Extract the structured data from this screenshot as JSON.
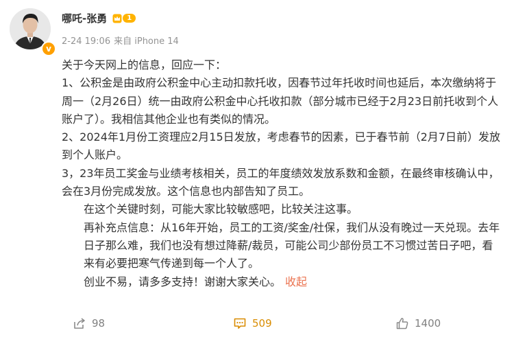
{
  "author": {
    "name": "哪吒-张勇",
    "level_badge": "1",
    "verified_mark": "v",
    "avatar": "avatar-photo"
  },
  "meta": {
    "time": "2-24 19:06",
    "source": "来自 iPhone 14"
  },
  "post": {
    "paragraphs": [
      "关于今天网上的信息，回应一下：",
      "1、公积金是由政府公积金中心主动扣款托收，因春节过年托收时间也延后，本次缴纳将于周一（2月26日）统一由政府公积金中心托收扣款（部分城市已经于2月23日前托收到个人账户了）。我相信其他企业也有类似的情况。",
      "2、2024年1月份工资理应2月15日发放，考虑春节的因素，已于春节前（2月7日前）发放到个人账户。",
      "3，23年员工奖金与业绩考核相关，员工的年度绩效发放系数和金额，在最终审核确认中，会在3月份完成发放。这个信息也内部告知了员工。",
      "在这个关键时刻，可能大家比较敏感吧，比较关注这事。",
      "再补充点信息：从16年开始，员工的工资/奖金/社保，我们从没有晚过一天兑现。去年日子那么难，我们也没有想过降薪/裁员，可能公司少部份员工不习惯过苦日子吧，看来有必要把寒气传递到每一个人了。",
      "创业不易，请多多支持！谢谢大家关心。"
    ],
    "collapse_label": "收起"
  },
  "actions": {
    "repost": {
      "icon": "share-icon",
      "count": "98"
    },
    "comment": {
      "icon": "comment-icon",
      "count": "509"
    },
    "like": {
      "icon": "thumbs-up-icon",
      "count": "1400"
    }
  },
  "colors": {
    "link": "#eb7350",
    "verified": "#ffa000",
    "comment_active": "#d98c00",
    "muted": "#939393"
  }
}
